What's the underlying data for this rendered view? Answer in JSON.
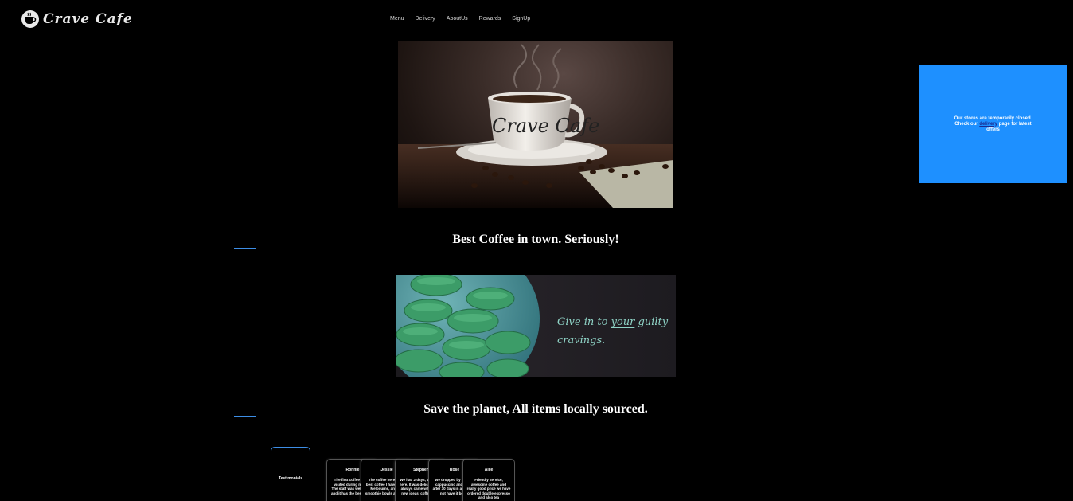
{
  "header": {
    "logo_text": "Crave Cafe",
    "nav": [
      {
        "label": "Menu"
      },
      {
        "label": "Delivery"
      },
      {
        "label": "AboutUs"
      },
      {
        "label": "Rewards"
      },
      {
        "label": "SignUp"
      }
    ]
  },
  "hero": {
    "cup_text": "Crave Cafe"
  },
  "sections": {
    "heading_1": "Best Coffee in town. Seriously!",
    "banner_text_1": "Give in to ",
    "banner_text_underline": "your",
    "banner_text_2": " guilty ",
    "banner_text_3": "cravings",
    "banner_text_4": ".",
    "heading_2": "Save the planet, All items locally sourced."
  },
  "notice": {
    "text_before": "Our stores are temporarily closed. Check our ",
    "link_label": "delivery",
    "text_after": " page for latest offers"
  },
  "testimonials": {
    "tab_label": "Testimonials",
    "cards": [
      {
        "name": "Ronnie",
        "text": "The first coffee shop I visited during my trip. The staff was welcoming and it has the best coffee"
      },
      {
        "name": "Jessie",
        "text": "The coffee here is the best coffee I have had in Melbourne, and the smoothie bowls are great"
      },
      {
        "name": "Stephen",
        "text": "We had 2 days, 4 coffees here. It was delicious and always came with some new ideas, coffee great"
      },
      {
        "name": "Rose",
        "text": "We dropped by to get a cappuccino and it was after 30 days in a row, did not have it better"
      },
      {
        "name": "Allie",
        "text": "Friendly service, awesome coffee and really good price we have ordered double espresso and also tea"
      }
    ]
  },
  "colors": {
    "background": "#000000",
    "accent_blue": "#1e90ff",
    "outline_blue": "#3d8ee6",
    "banner_text": "#8fd3c6"
  }
}
